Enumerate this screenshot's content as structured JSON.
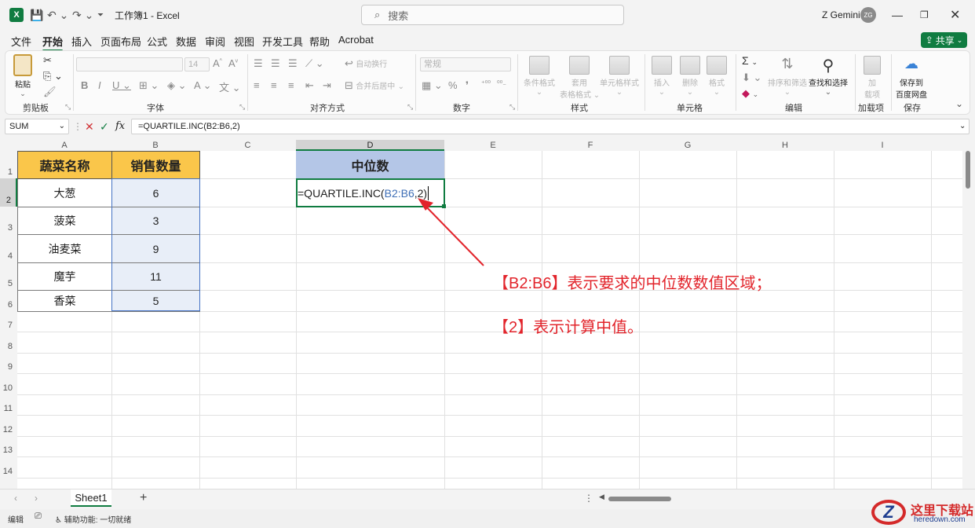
{
  "window": {
    "app_icon": "X",
    "title": "工作簿1 - Excel",
    "search_placeholder": "搜索",
    "user_name": "Z Gemini",
    "avatar_initials": "ZG"
  },
  "menu": {
    "tabs": [
      "文件",
      "开始",
      "插入",
      "页面布局",
      "公式",
      "数据",
      "审阅",
      "视图",
      "开发工具",
      "帮助",
      "Acrobat"
    ],
    "active": "开始",
    "share_label": "共享"
  },
  "ribbon": {
    "paste_label": "粘贴",
    "font_name": "",
    "font_size": "14",
    "wrap_text": "自动换行",
    "merge_center": "合并后居中",
    "number_format": "常规",
    "cond_format": "条件格式",
    "table_format_1": "套用",
    "table_format_2": "表格格式",
    "cell_style": "单元格样式",
    "insert": "插入",
    "delete": "删除",
    "format": "格式",
    "sort_filter": "排序和筛选",
    "find_select": "查找和选择",
    "addin_1": "加",
    "addin_2": "载项",
    "save_baidu_1": "保存到",
    "save_baidu_2": "百度网盘",
    "groups": {
      "clipboard": "剪贴板",
      "font": "字体",
      "alignment": "对齐方式",
      "number": "数字",
      "styles": "样式",
      "cells": "单元格",
      "editing": "编辑",
      "addins": "加载项",
      "save": "保存"
    }
  },
  "formula_bar": {
    "name_box": "SUM",
    "formula": "=QUARTILE.INC(B2:B6,2)"
  },
  "grid": {
    "columns": [
      "A",
      "B",
      "C",
      "D",
      "E",
      "F",
      "G",
      "H",
      "I"
    ],
    "rows": [
      "1",
      "2",
      "3",
      "4",
      "5",
      "6",
      "7",
      "8",
      "9",
      "10",
      "11",
      "12",
      "13",
      "14"
    ],
    "header_a": "蔬菜名称",
    "header_b": "销售数量",
    "header_d": "中位数",
    "vegetables": [
      "大葱",
      "菠菜",
      "油麦菜",
      "魔芋",
      "香菜"
    ],
    "quantities": [
      "6",
      "3",
      "9",
      "11",
      "5"
    ],
    "edit_prefix": "=QUARTILE.INC(",
    "edit_ref": "B2:B6",
    "edit_suffix": ",2)",
    "header_color": "#fac64a",
    "median_header_color": "#b4c6e7"
  },
  "annotations": {
    "line1": "【B2:B6】表示要求的中位数数值区域；",
    "line2": "【2】表示计算中值。",
    "color": "#e2242b"
  },
  "sheets": {
    "active": "Sheet1"
  },
  "status": {
    "mode": "编辑",
    "accessibility": "辅助功能: 一切就绪"
  },
  "watermark": {
    "brand": "这里下载站",
    "domain": "heredown.com"
  }
}
